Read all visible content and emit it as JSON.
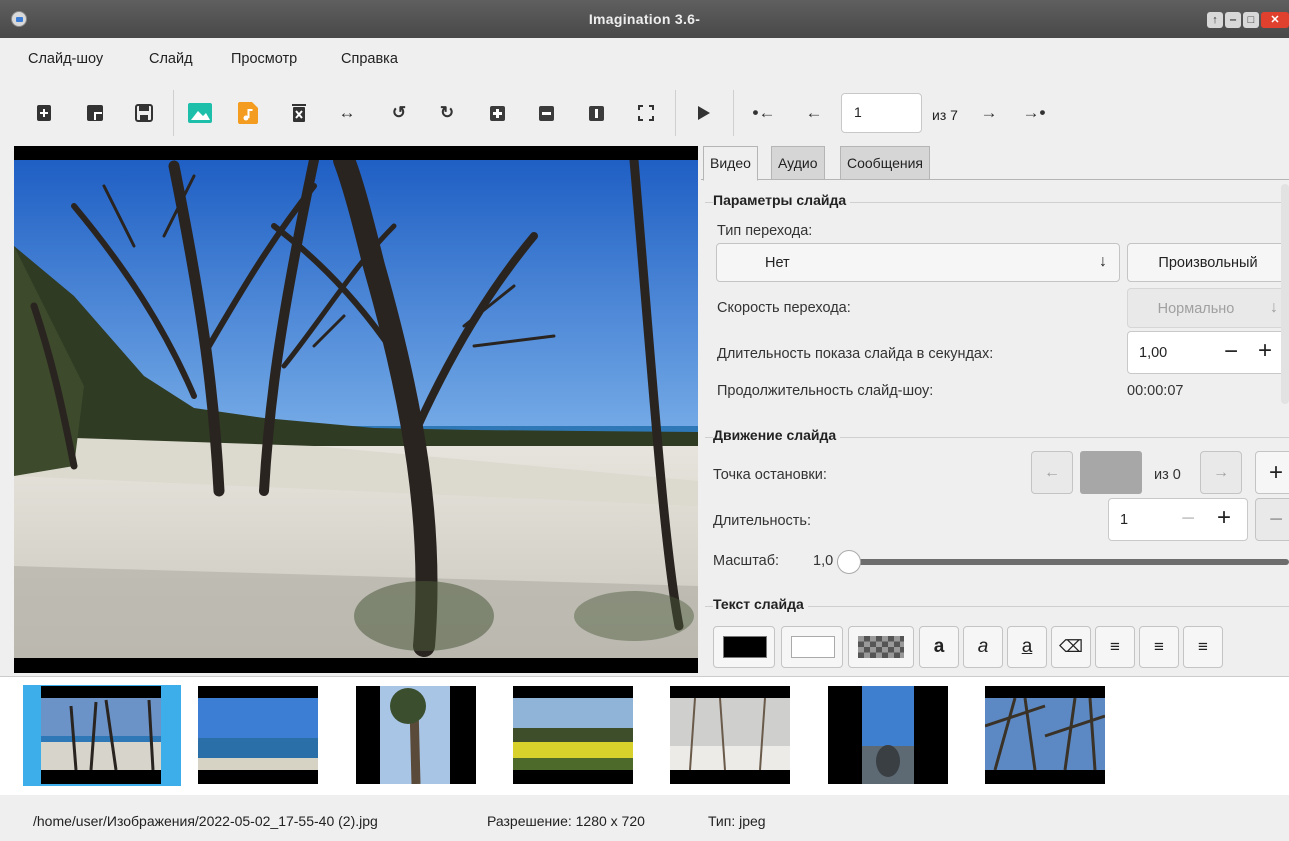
{
  "window": {
    "title": "Imagination 3.6-"
  },
  "menu": {
    "items": [
      "Слайд-шоу",
      "Слайд",
      "Просмотр",
      "Справка"
    ]
  },
  "toolbar": {
    "icons": [
      "new-slideshow-icon",
      "open-slideshow-icon",
      "save-slideshow-icon",
      "import-pictures-icon",
      "import-music-icon",
      "delete-slide-icon",
      "flip-icon",
      "rotate-left-icon",
      "rotate-right-icon",
      "zoom-in-icon",
      "zoom-out-icon",
      "zoom-normal-icon",
      "zoom-fit-icon",
      "play-icon",
      "first-slide-icon",
      "previous-slide-icon",
      "next-slide-icon",
      "last-slide-icon"
    ],
    "current_slide": "1",
    "slide_of": "из 7"
  },
  "tabs": [
    "Видео",
    "Аудио",
    "Сообщения"
  ],
  "slide_params": {
    "title": "Параметры слайда",
    "transition_type_label": "Тип перехода:",
    "transition_value": "Нет",
    "random_button": "Произвольный",
    "speed_label": "Скорость перехода:",
    "speed_value": "Нормально",
    "duration_label": "Длительность показа слайда в секундах:",
    "duration_value": "1,00",
    "total_label": "Продолжительность слайд-шоу:",
    "total_value": "00:00:07"
  },
  "motion": {
    "title": "Движение слайда",
    "stop_point_label": "Точка остановки:",
    "stop_of": "из 0",
    "duration_label": "Длительность:",
    "duration_value": "1",
    "zoom_label": "Масштаб:",
    "zoom_value": "1,0",
    "zoom_level": 0
  },
  "slide_text": {
    "title": "Текст слайда",
    "font_color": "#000000",
    "bg_color": "#ffffff",
    "format_glyphs": [
      "a",
      "a",
      "a"
    ]
  },
  "thumbnails_count": 7,
  "status": {
    "path": "/home/user/Изображения/2022-05-02_17-55-40 (2).jpg",
    "resolution": "Разрешение: 1280 x 720",
    "type": "Тип: jpeg"
  },
  "colors": {
    "accent": "#3daee9",
    "titlebar": "#4f4f4f",
    "close": "#e0412f"
  }
}
